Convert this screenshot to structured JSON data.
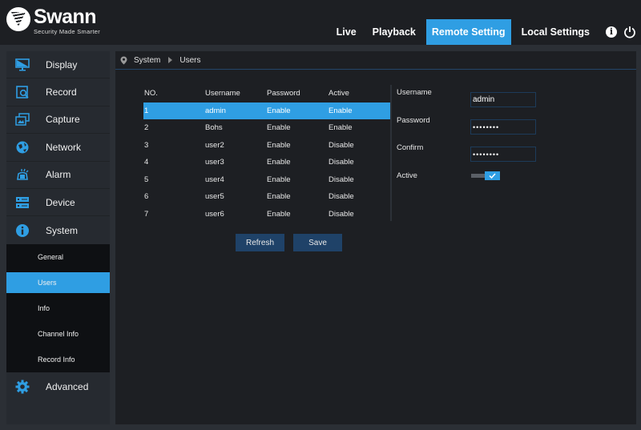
{
  "brand": {
    "name": "Swann",
    "tagline": "Security Made Smarter"
  },
  "nav": {
    "items": [
      {
        "label": "Live",
        "active": false
      },
      {
        "label": "Playback",
        "active": false
      },
      {
        "label": "Remote Setting",
        "active": true
      },
      {
        "label": "Local Settings",
        "active": false
      }
    ],
    "icons": [
      "info-icon",
      "power-icon"
    ]
  },
  "sidebar": {
    "items": [
      {
        "label": "Display",
        "icon": "monitor-icon"
      },
      {
        "label": "Record",
        "icon": "record-search-icon"
      },
      {
        "label": "Capture",
        "icon": "capture-icon"
      },
      {
        "label": "Network",
        "icon": "globe-icon"
      },
      {
        "label": "Alarm",
        "icon": "alarm-siren-icon"
      },
      {
        "label": "Device",
        "icon": "device-hdd-icon"
      },
      {
        "label": "System",
        "icon": "info-circle-icon"
      }
    ],
    "submenu": [
      {
        "label": "General",
        "active": false
      },
      {
        "label": "Users",
        "active": true
      },
      {
        "label": "Info",
        "active": false
      },
      {
        "label": "Channel Info",
        "active": false
      },
      {
        "label": "Record Info",
        "active": false
      }
    ],
    "advanced": {
      "label": "Advanced",
      "icon": "gear-icon"
    }
  },
  "breadcrumb": {
    "icon": "location-pin-icon",
    "parent": "System",
    "current": "Users"
  },
  "users_table": {
    "columns": [
      "NO.",
      "Username",
      "Password",
      "Active"
    ],
    "rows": [
      {
        "no": "1",
        "username": "admin",
        "password": "Enable",
        "active": "Enable",
        "selected": true
      },
      {
        "no": "2",
        "username": "Bohs",
        "password": "Enable",
        "active": "Enable",
        "selected": false
      },
      {
        "no": "3",
        "username": "user2",
        "password": "Enable",
        "active": "Disable",
        "selected": false
      },
      {
        "no": "4",
        "username": "user3",
        "password": "Enable",
        "active": "Disable",
        "selected": false
      },
      {
        "no": "5",
        "username": "user4",
        "password": "Enable",
        "active": "Disable",
        "selected": false
      },
      {
        "no": "6",
        "username": "user5",
        "password": "Enable",
        "active": "Disable",
        "selected": false
      },
      {
        "no": "7",
        "username": "user6",
        "password": "Enable",
        "active": "Disable",
        "selected": false
      }
    ]
  },
  "form": {
    "username_label": "Username",
    "username_value": "admin",
    "password_label": "Password",
    "password_value": "••••••••",
    "confirm_label": "Confirm",
    "confirm_value": "••••••••",
    "active_label": "Active",
    "active_checked": true
  },
  "buttons": {
    "refresh": "Refresh",
    "save": "Save"
  },
  "colors": {
    "accent": "#2f9ee3",
    "button": "#1f4268",
    "panel": "#1d1f23",
    "sidebar": "#262a30"
  }
}
